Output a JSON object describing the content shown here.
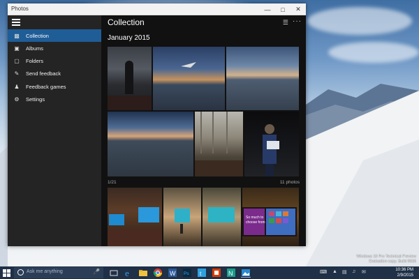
{
  "window": {
    "title": "Photos"
  },
  "nav": {
    "items": [
      {
        "label": "Collection",
        "icon": "collection-icon",
        "active": true
      },
      {
        "label": "Albums",
        "icon": "albums-icon"
      },
      {
        "label": "Folders",
        "icon": "folders-icon"
      },
      {
        "label": "Send feedback",
        "icon": "feedback-icon"
      },
      {
        "label": "Feedback games",
        "icon": "games-icon"
      },
      {
        "label": "Settings",
        "icon": "gear-icon"
      }
    ]
  },
  "main": {
    "title": "Collection",
    "month": "January 2015",
    "footer_left": "1/21",
    "footer_right": "11 photos"
  },
  "taskbar": {
    "search_placeholder": "Ask me anything",
    "time": "10:36 PM",
    "date": "2/9/2015"
  },
  "watermark": {
    "line1": "Windows 10 Pro Technical Preview",
    "line2": "Evaluation copy. Build 9926"
  },
  "colors": {
    "accent": "#1f5d97",
    "taskbar": "#1f3047"
  }
}
